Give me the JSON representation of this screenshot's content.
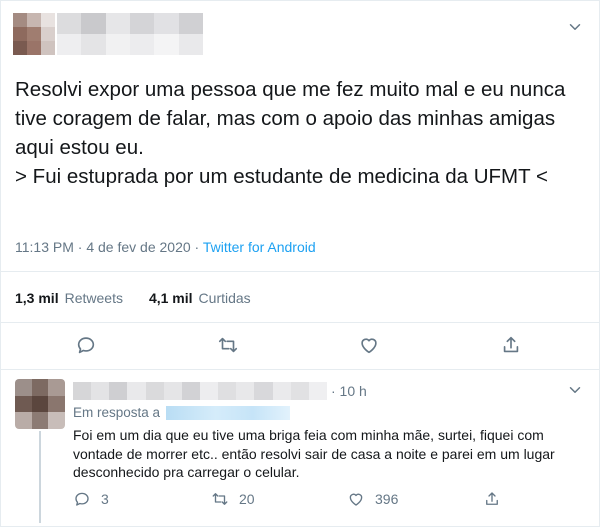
{
  "tweet": {
    "text": "Resolvi expor uma pessoa que me fez muito mal e eu nunca tive coragem de falar, mas com o apoio das minhas amigas aqui estou eu.\n> Fui estuprada por um estudante de medicina da UFMT <",
    "time": "11:13 PM · 4 de fev de 2020 ·",
    "source": "Twitter for Android",
    "retweets_count": "1,3 mil",
    "retweets_label": "Retweets",
    "likes_count": "4,1 mil",
    "likes_label": "Curtidas"
  },
  "reply": {
    "time": "· 10 h",
    "in_reply_to_label": "Em resposta a",
    "text": "Foi em um dia que eu tive uma briga feia com minha mãe, surtei, fiquei com vontade de morrer etc.. então resolvi sair de casa a noite e parei em um lugar desconhecido pra carregar o celular.",
    "reply_count": "3",
    "retweet_count": "20",
    "like_count": "396"
  },
  "icons": {
    "more": "chevron-down-icon",
    "reply": "reply-icon",
    "retweet": "retweet-icon",
    "like": "heart-icon",
    "share": "share-icon"
  },
  "colors": {
    "link": "#1da1f2",
    "secondary_text": "#657786",
    "border": "#e6ecf0"
  }
}
